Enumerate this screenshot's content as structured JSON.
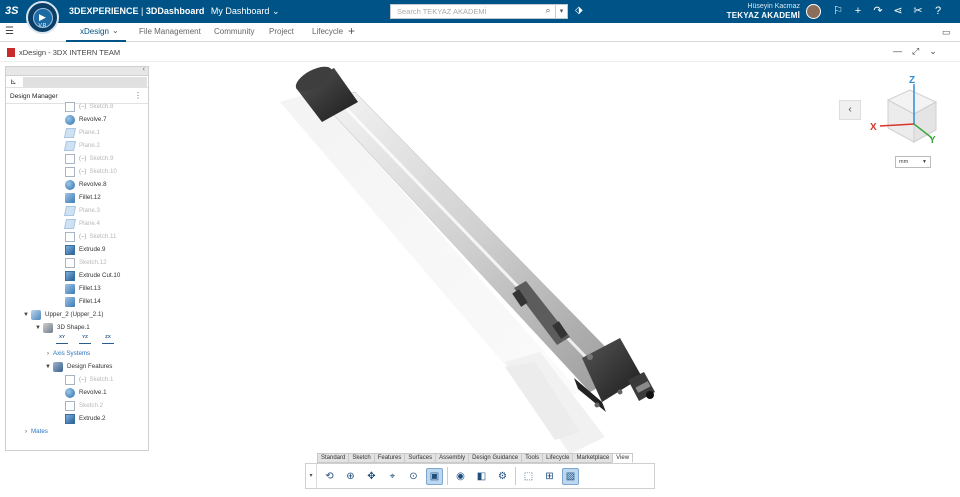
{
  "topbar": {
    "logo": "3S",
    "brand_prefix": "3DEXPERIENCE",
    "brand_separator": " | ",
    "brand_app": "3DDashboard",
    "dashboard": "My Dashboard",
    "dashboard_caret": "⌄",
    "search_placeholder": "Search TEKYAZ AKADEMİ",
    "user_name": "Hüseyin Kacmaz",
    "organization": "TEKYAZ AKADEMİ",
    "compass_vr": "V.R"
  },
  "tabs": [
    {
      "label": "xDesign"
    },
    {
      "label": "File Management"
    },
    {
      "label": "Community"
    },
    {
      "label": "Project"
    },
    {
      "label": "Lifecycle"
    }
  ],
  "app": {
    "title": "xDesign - 3DX INTERN TEAM"
  },
  "design_manager": {
    "title": "Design Manager",
    "rows": [
      {
        "label": "Sketch.8",
        "icon": "sketch",
        "dim": true
      },
      {
        "label": "Revolve.7",
        "icon": "revolve",
        "dim": false
      },
      {
        "label": "Plane.1",
        "icon": "plane",
        "dim": true
      },
      {
        "label": "Plane.2",
        "icon": "plane",
        "dim": true
      },
      {
        "label": "Sketch.9",
        "icon": "sketch",
        "dim": true
      },
      {
        "label": "Sketch.10",
        "icon": "sketch",
        "dim": true
      },
      {
        "label": "Revolve.8",
        "icon": "revolve",
        "dim": false
      },
      {
        "label": "Fillet.12",
        "icon": "fillet",
        "dim": false
      },
      {
        "label": "Plane.3",
        "icon": "plane",
        "dim": true
      },
      {
        "label": "Plane.4",
        "icon": "plane",
        "dim": true
      },
      {
        "label": "Sketch.11",
        "icon": "sketch",
        "dim": true
      },
      {
        "label": "Extrude.9",
        "icon": "extrude",
        "dim": false
      },
      {
        "label": "Sketch.12",
        "icon": "sketch",
        "dim": true
      },
      {
        "label": "Extrude Cut.10",
        "icon": "extrude",
        "dim": false
      },
      {
        "label": "Fillet.13",
        "icon": "fillet",
        "dim": false
      },
      {
        "label": "Fillet.14",
        "icon": "fillet",
        "dim": false
      }
    ],
    "upper": "Upper_2 (Upper_2.1)",
    "shape": "3D Shape.1",
    "axis_planes": [
      "XY",
      "YZ",
      "ZX"
    ],
    "axis_systems": "Axis Systems",
    "design_features": "Design Features",
    "sub_rows": [
      {
        "label": "Sketch.1",
        "icon": "sketch",
        "dim": true
      },
      {
        "label": "Revolve.1",
        "icon": "revolve",
        "dim": false
      },
      {
        "label": "Sketch.2",
        "icon": "sketch",
        "dim": true
      },
      {
        "label": "Extrude.2",
        "icon": "extrude",
        "dim": false
      }
    ],
    "mates": "Mates"
  },
  "viewport": {
    "unit": "mm",
    "axis_x": "X",
    "axis_y": "Y",
    "axis_z": "Z"
  },
  "action_tabs": [
    "Standard",
    "Sketch",
    "Features",
    "Surfaces",
    "Assembly",
    "Design Guidance",
    "Tools",
    "Lifecycle",
    "Marketplace",
    "View"
  ],
  "active_action_tab": "View",
  "colors": {
    "topbar": "#005386",
    "accent": "#005386",
    "app_badge": "#c92a2a",
    "axis_x": "#d9342b",
    "axis_y": "#3fa63f",
    "axis_z": "#2c8fd6"
  }
}
